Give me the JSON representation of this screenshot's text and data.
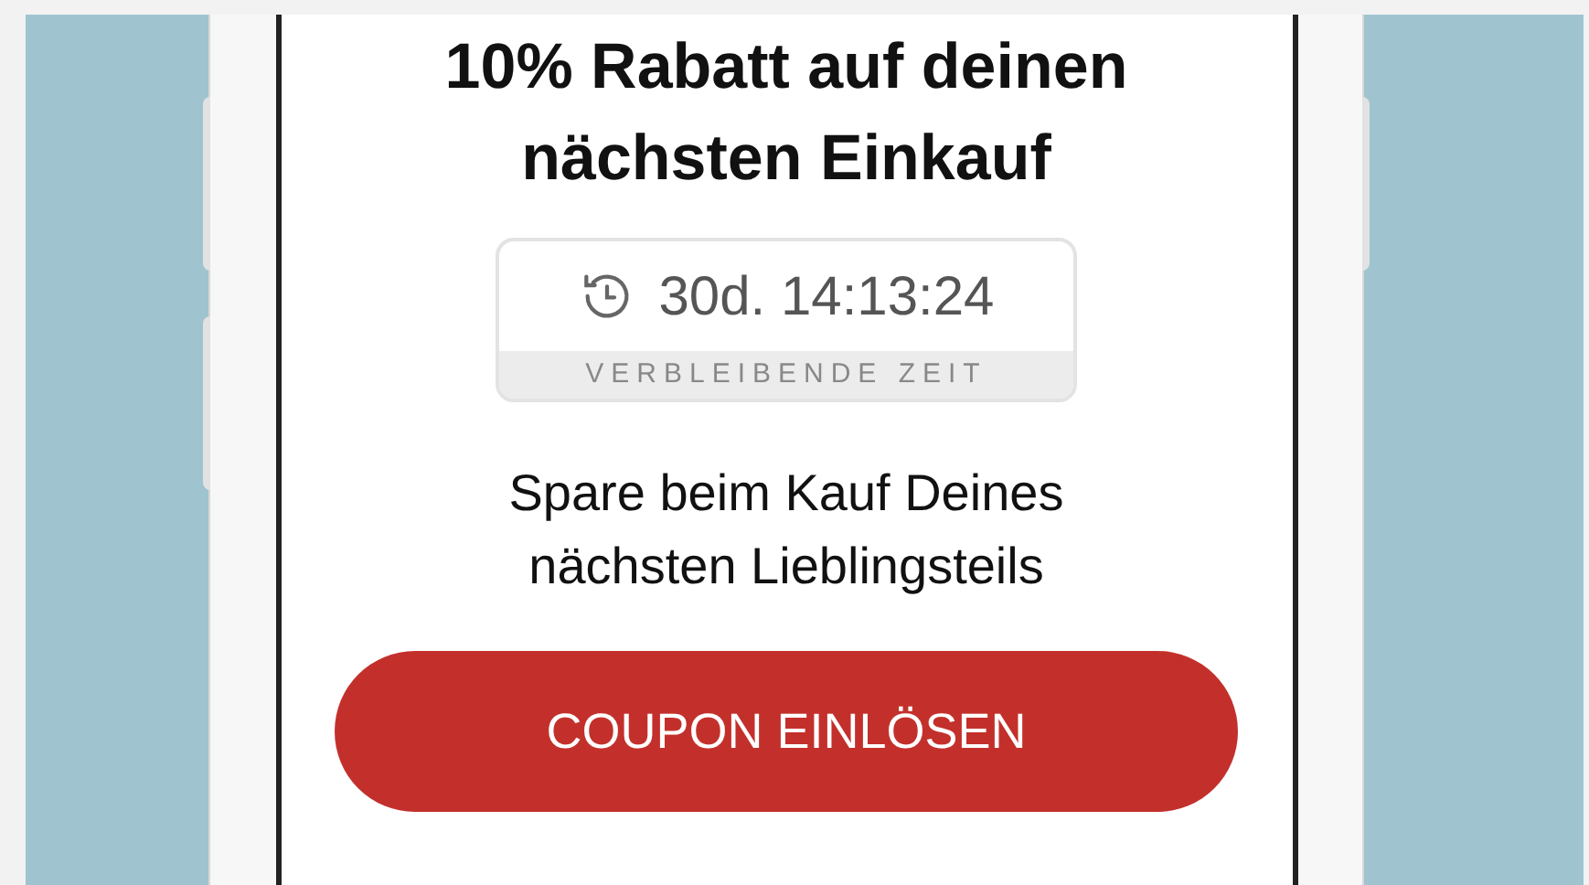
{
  "offer": {
    "title": "10% Rabatt auf deinen nächsten Einkauf",
    "timer": {
      "value": "30d. 14:13:24",
      "label": "VERBLEIBENDE ZEIT"
    },
    "description": "Spare beim Kauf Deines nächsten Lieblingsteils",
    "button": "COUPON EINLÖSEN"
  }
}
